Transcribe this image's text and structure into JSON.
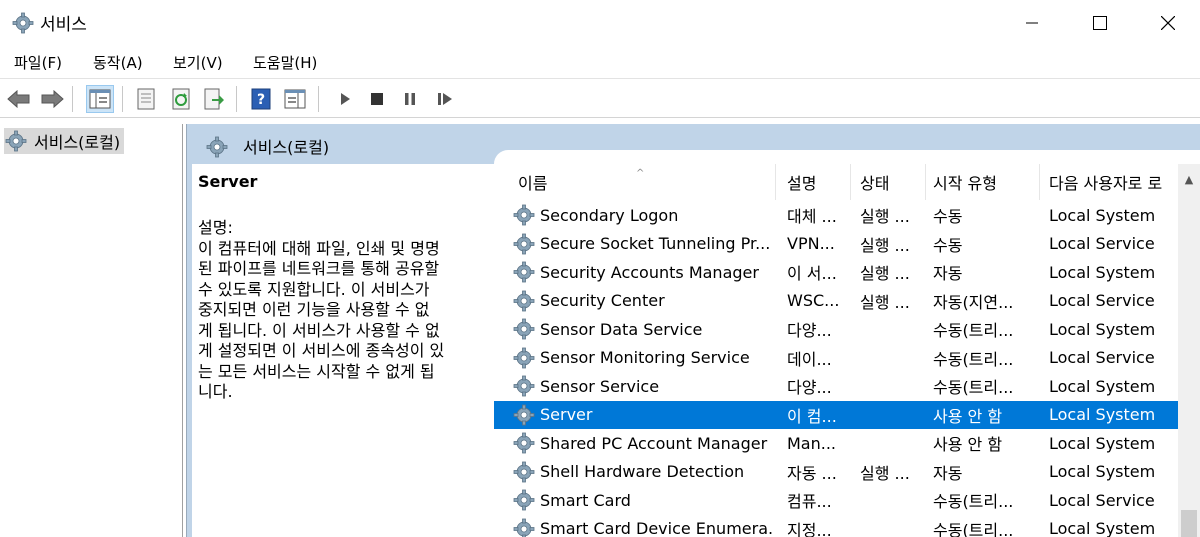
{
  "window": {
    "title": "서비스"
  },
  "menu": [
    "파일(F)",
    "동작(A)",
    "보기(V)",
    "도움말(H)"
  ],
  "toolbar": {
    "icons": [
      "back-arrow-icon",
      "forward-arrow-icon",
      "console-tree-icon",
      "properties-icon",
      "refresh-icon",
      "export-list-icon",
      "help-icon",
      "show-action-pane-icon",
      "start-service-icon",
      "stop-service-icon",
      "pause-service-icon",
      "restart-service-icon"
    ]
  },
  "tree": {
    "item": "서비스(로컬)"
  },
  "panel": {
    "title": "서비스(로컬)"
  },
  "description": {
    "service_name": "Server",
    "text": "설명:\n이 컴퓨터에 대해 파일, 인쇄 및 명명\n된 파이프를 네트워크를 통해 공유할\n수 있도록 지원합니다. 이 서비스가\n중지되면 이런 기능을 사용할 수 없\n게 됩니다. 이 서비스가 사용할 수 없\n게 설정되면 이 서비스에 종속성이 있\n는 모든 서비스는 시작할 수 없게 됩\n니다."
  },
  "columns": {
    "name": "이름",
    "description": "설명",
    "status": "상태",
    "startup": "시작 유형",
    "logon": "다음 사용자로 로"
  },
  "sort_indicator": "^",
  "services": [
    {
      "name": "Secondary Logon",
      "desc": "대체 ...",
      "status": "실행 ...",
      "startup": "수동",
      "logon": "Local System"
    },
    {
      "name": "Secure Socket Tunneling Pr...",
      "desc": "VPN...",
      "status": "실행 ...",
      "startup": "수동",
      "logon": "Local Service"
    },
    {
      "name": "Security Accounts Manager",
      "desc": "이 서...",
      "status": "실행 ...",
      "startup": "자동",
      "logon": "Local System"
    },
    {
      "name": "Security Center",
      "desc": "WSC...",
      "status": "실행 ...",
      "startup": "자동(지연...",
      "logon": "Local Service"
    },
    {
      "name": "Sensor Data Service",
      "desc": "다양...",
      "status": "",
      "startup": "수동(트리...",
      "logon": "Local System"
    },
    {
      "name": "Sensor Monitoring Service",
      "desc": "데이...",
      "status": "",
      "startup": "수동(트리...",
      "logon": "Local Service"
    },
    {
      "name": "Sensor Service",
      "desc": "다양...",
      "status": "",
      "startup": "수동(트리...",
      "logon": "Local System"
    },
    {
      "name": "Server",
      "desc": "이 컴...",
      "status": "",
      "startup": "사용 안 함",
      "logon": "Local System",
      "selected": true
    },
    {
      "name": "Shared PC Account Manager",
      "desc": "Man...",
      "status": "",
      "startup": "사용 안 함",
      "logon": "Local System"
    },
    {
      "name": "Shell Hardware Detection",
      "desc": "자동 ...",
      "status": "실행 ...",
      "startup": "자동",
      "logon": "Local System"
    },
    {
      "name": "Smart Card",
      "desc": "컴퓨...",
      "status": "",
      "startup": "수동(트리...",
      "logon": "Local Service"
    },
    {
      "name": "Smart Card Device Enumera...",
      "desc": "지정...",
      "status": "",
      "startup": "수동(트리...",
      "logon": "Local System"
    }
  ],
  "colors": {
    "selection": "#0078d7",
    "panel_header": "#c0d4e8"
  }
}
